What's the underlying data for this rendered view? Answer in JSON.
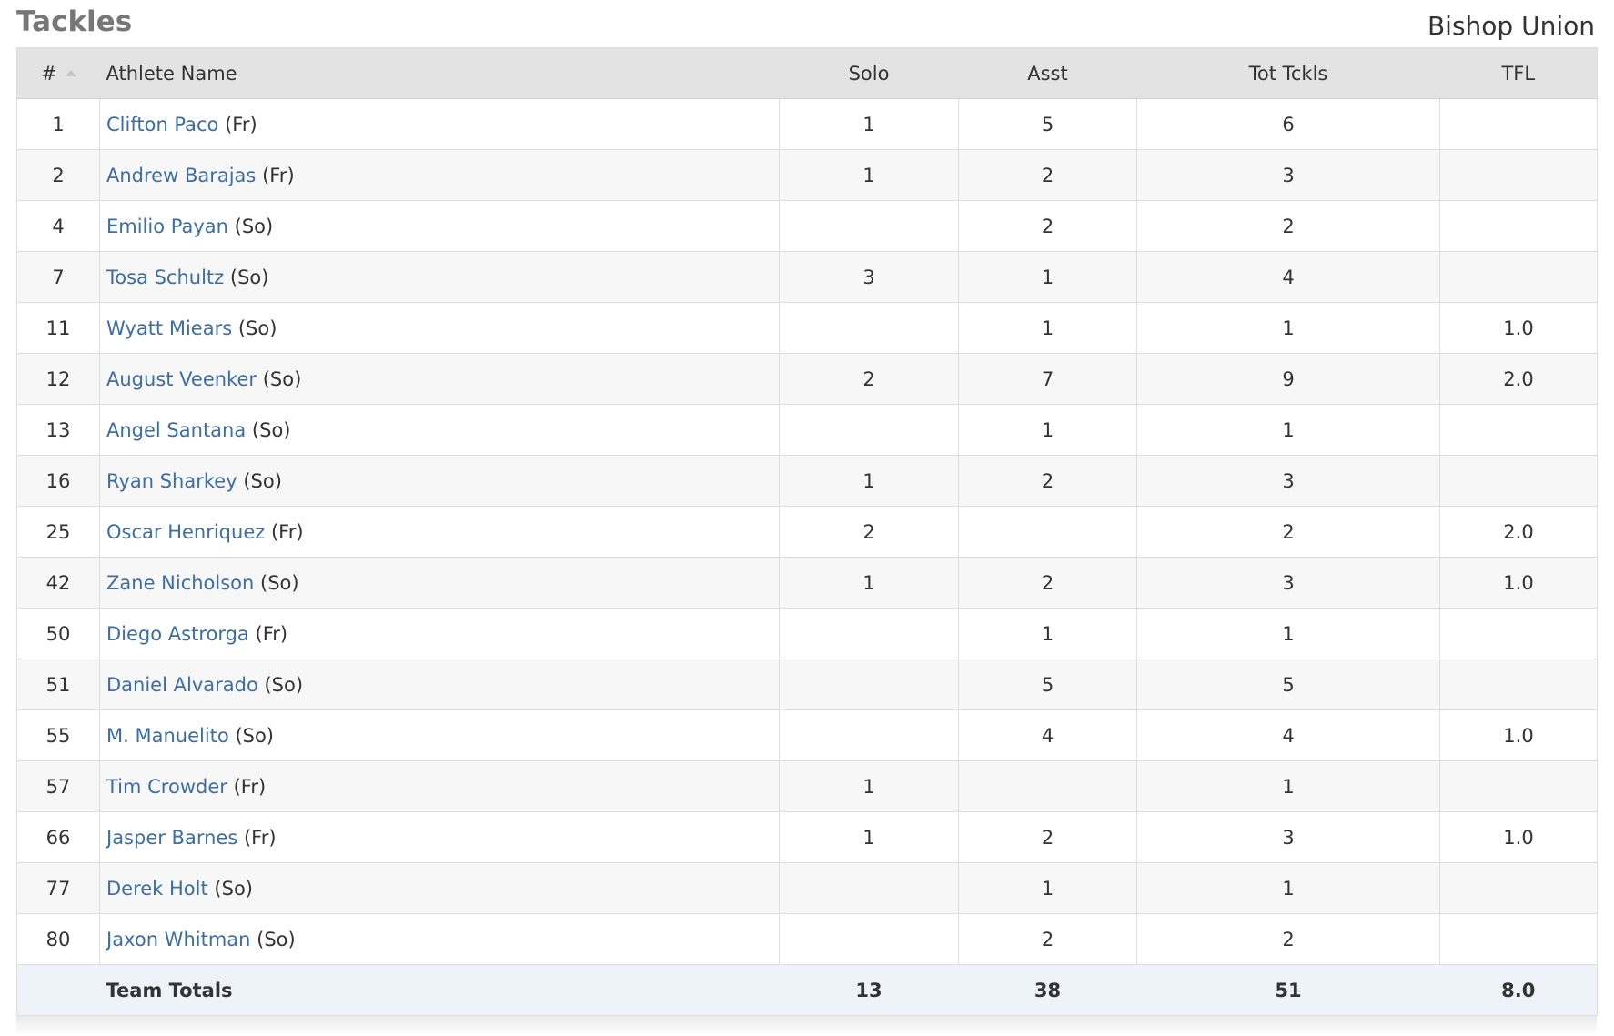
{
  "header": {
    "title": "Tackles",
    "team": "Bishop Union"
  },
  "table": {
    "columns": [
      "#",
      "Athlete Name",
      "Solo",
      "Asst",
      "Tot Tckls",
      "TFL"
    ],
    "rows": [
      {
        "num": "1",
        "name": "Clifton Paco",
        "class": "(Fr)",
        "solo": "1",
        "asst": "5",
        "tot": "6",
        "tfl": ""
      },
      {
        "num": "2",
        "name": "Andrew Barajas",
        "class": "(Fr)",
        "solo": "1",
        "asst": "2",
        "tot": "3",
        "tfl": ""
      },
      {
        "num": "4",
        "name": "Emilio Payan",
        "class": "(So)",
        "solo": "",
        "asst": "2",
        "tot": "2",
        "tfl": ""
      },
      {
        "num": "7",
        "name": "Tosa Schultz",
        "class": "(So)",
        "solo": "3",
        "asst": "1",
        "tot": "4",
        "tfl": ""
      },
      {
        "num": "11",
        "name": "Wyatt Miears",
        "class": "(So)",
        "solo": "",
        "asst": "1",
        "tot": "1",
        "tfl": "1.0"
      },
      {
        "num": "12",
        "name": "August Veenker",
        "class": "(So)",
        "solo": "2",
        "asst": "7",
        "tot": "9",
        "tfl": "2.0"
      },
      {
        "num": "13",
        "name": "Angel Santana",
        "class": "(So)",
        "solo": "",
        "asst": "1",
        "tot": "1",
        "tfl": ""
      },
      {
        "num": "16",
        "name": "Ryan Sharkey",
        "class": "(So)",
        "solo": "1",
        "asst": "2",
        "tot": "3",
        "tfl": ""
      },
      {
        "num": "25",
        "name": "Oscar Henriquez",
        "class": "(Fr)",
        "solo": "2",
        "asst": "",
        "tot": "2",
        "tfl": "2.0"
      },
      {
        "num": "42",
        "name": "Zane Nicholson",
        "class": "(So)",
        "solo": "1",
        "asst": "2",
        "tot": "3",
        "tfl": "1.0"
      },
      {
        "num": "50",
        "name": "Diego Astrorga",
        "class": "(Fr)",
        "solo": "",
        "asst": "1",
        "tot": "1",
        "tfl": ""
      },
      {
        "num": "51",
        "name": "Daniel Alvarado",
        "class": "(So)",
        "solo": "",
        "asst": "5",
        "tot": "5",
        "tfl": ""
      },
      {
        "num": "55",
        "name": "M. Manuelito",
        "class": "(So)",
        "solo": "",
        "asst": "4",
        "tot": "4",
        "tfl": "1.0"
      },
      {
        "num": "57",
        "name": "Tim Crowder",
        "class": "(Fr)",
        "solo": "1",
        "asst": "",
        "tot": "1",
        "tfl": ""
      },
      {
        "num": "66",
        "name": "Jasper Barnes",
        "class": "(Fr)",
        "solo": "1",
        "asst": "2",
        "tot": "3",
        "tfl": "1.0"
      },
      {
        "num": "77",
        "name": "Derek Holt",
        "class": "(So)",
        "solo": "",
        "asst": "1",
        "tot": "1",
        "tfl": ""
      },
      {
        "num": "80",
        "name": "Jaxon Whitman",
        "class": "(So)",
        "solo": "",
        "asst": "2",
        "tot": "2",
        "tfl": ""
      }
    ],
    "totals": {
      "label": "Team Totals",
      "solo": "13",
      "asst": "38",
      "tot": "51",
      "tfl": "8.0"
    }
  },
  "colors": {
    "link": "#3a6ea5",
    "header_bg": "#e3e3e3",
    "totals_bg": "#eef3f9",
    "stripe": "#f7f7f7"
  },
  "icons": {
    "sort": "sort-ascending-caret-icon"
  }
}
